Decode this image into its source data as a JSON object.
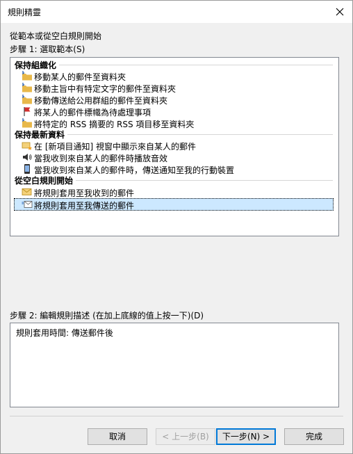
{
  "window": {
    "title": "規則精靈"
  },
  "intro_text": "從範本或從空白規則開始",
  "step1": {
    "label": "步驟 1: 選取範本(S)",
    "groups": [
      {
        "header": "保持組織化",
        "items": [
          {
            "label": "移動某人的郵件至資料夾",
            "icon": "folder-move-icon"
          },
          {
            "label": "移動主旨中有特定文字的郵件至資料夾",
            "icon": "folder-move-icon"
          },
          {
            "label": "移動傳送給公用群組的郵件至資料夾",
            "icon": "folder-move-icon"
          },
          {
            "label": "將某人的郵件標幟為待處理事項",
            "icon": "flag-icon"
          },
          {
            "label": "將特定的 RSS 摘要的 RSS 項目移至資料夾",
            "icon": "folder-move-icon"
          }
        ]
      },
      {
        "header": "保持最新資料",
        "items": [
          {
            "label": "在 [新項目通知] 視窗中顯示來自某人的郵件",
            "icon": "new-item-alert-icon"
          },
          {
            "label": "當我收到來自某人的郵件時播放音效",
            "icon": "speaker-icon"
          },
          {
            "label": "當我收到來自某人的郵件時，傳送通知至我的行動裝置",
            "icon": "mobile-device-icon"
          }
        ]
      },
      {
        "header": "從空白規則開始",
        "items": [
          {
            "label": "將規則套用至我收到的郵件",
            "icon": "envelope-icon"
          },
          {
            "label": "將規則套用至我傳送的郵件",
            "icon": "send-envelope-icon",
            "selected": true
          }
        ]
      }
    ]
  },
  "step2": {
    "label": "步驟 2: 編輯規則描述 (在加上底線的值上按一下)(D)",
    "description": "規則套用時間: 傳送郵件後"
  },
  "buttons": {
    "cancel": "取消",
    "back": "< 上一步(B)",
    "next": "下一步(N) >",
    "finish": "完成"
  }
}
